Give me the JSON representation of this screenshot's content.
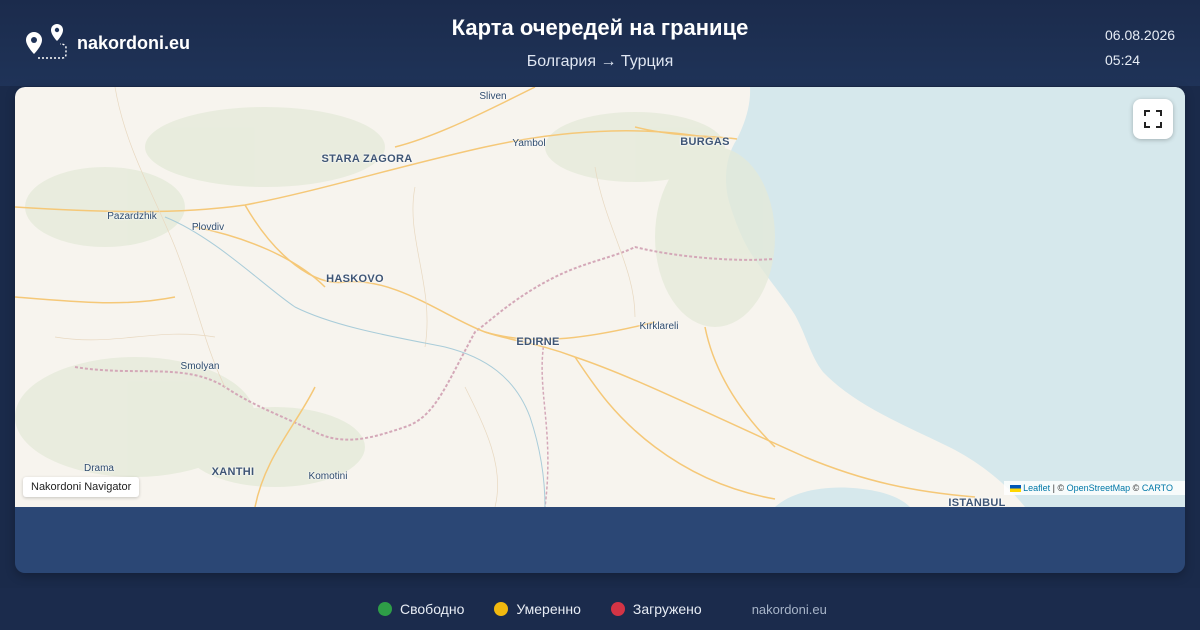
{
  "header": {
    "site_name": "nakordoni.eu",
    "title": "Карта очередей на границе",
    "route": "Болгария → Турция",
    "date": "06.08.2026",
    "time": "05:24"
  },
  "map": {
    "cities": [
      {
        "name": "Sliven",
        "major": false
      },
      {
        "name": "Yambol",
        "major": false
      },
      {
        "name": "BURGAS",
        "major": true
      },
      {
        "name": "STARA ZAGORA",
        "major": true
      },
      {
        "name": "Pazardzhik",
        "major": false
      },
      {
        "name": "Plovdiv",
        "major": false
      },
      {
        "name": "HASKOVO",
        "major": true
      },
      {
        "name": "EDIRNE",
        "major": true
      },
      {
        "name": "Kırklareli",
        "major": false
      },
      {
        "name": "Smolyan",
        "major": false
      },
      {
        "name": "Drama",
        "major": false
      },
      {
        "name": "XANTHI",
        "major": true
      },
      {
        "name": "Komotini",
        "major": false
      },
      {
        "name": "ISTANBUL",
        "major": true
      }
    ],
    "nav_label": "Nakordoni Navigator",
    "attribution": {
      "leaflet": "Leaflet",
      "sep1": " | © ",
      "osm": "OpenStreetMap",
      "sep2": " © ",
      "carto": "CARTO"
    },
    "fullscreen_icon": "fullscreen-icon"
  },
  "legend": {
    "items": [
      {
        "label": "Свободно",
        "color": "#2e9e47"
      },
      {
        "label": "Умеренно",
        "color": "#f1b90f"
      },
      {
        "label": "Загружено",
        "color": "#d33445"
      }
    ],
    "site": "nakordoni.eu"
  },
  "colors": {
    "header_bg": "#1b2b4c",
    "panel_bg": "#2b4775",
    "sea": "#d6e8ec",
    "land": "#f7f4ee"
  }
}
